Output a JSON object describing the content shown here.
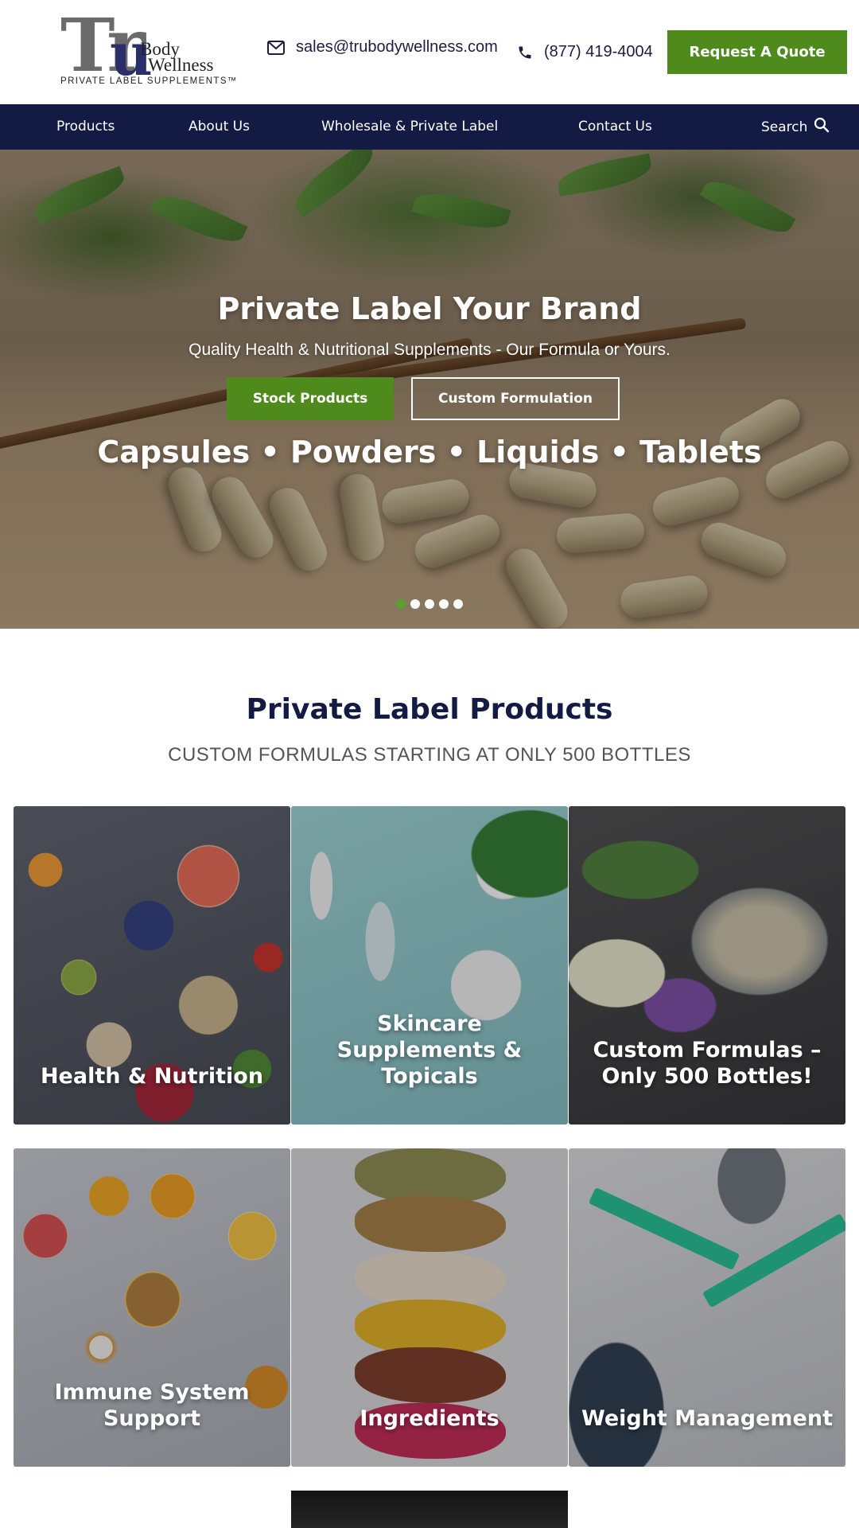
{
  "brand": {
    "logo_letters": "Tru",
    "logo_body": "Body",
    "logo_wellness": "Wellness",
    "tagline": "PRIVATE LABEL SUPPLEMENTS™"
  },
  "header": {
    "email": "sales@trubodywellness.com",
    "phone": "(877) 419-4004",
    "quote_button": "Request A Quote"
  },
  "nav": {
    "items": [
      "Products",
      "About Us",
      "Wholesale & Private Label",
      "Contact Us"
    ],
    "search_label": "Search"
  },
  "hero": {
    "title": "Private Label Your Brand",
    "subtitle": "Quality Health & Nutritional Supplements - Our Formula or Yours.",
    "primary_button": "Stock Products",
    "secondary_button": "Custom Formulation",
    "formats": "Capsules • Powders • Liquids • Tablets",
    "slide_count": 5,
    "active_slide": 1
  },
  "products": {
    "title": "Private Label Products",
    "subtitle": "CUSTOM FORMULAS STARTING AT ONLY 500 BOTTLES",
    "tiles": [
      "Health & Nutrition",
      "Skincare Supplements & Topicals",
      "Custom Formulas – Only 500 Bottles!",
      "Immune System Support",
      "Ingredients",
      "Weight Management"
    ]
  },
  "colors": {
    "navy": "#131a43",
    "green": "#4e8a1c",
    "white": "#ffffff"
  },
  "icons": {
    "email": "mail-icon",
    "phone": "phone-icon",
    "search": "search-icon"
  }
}
